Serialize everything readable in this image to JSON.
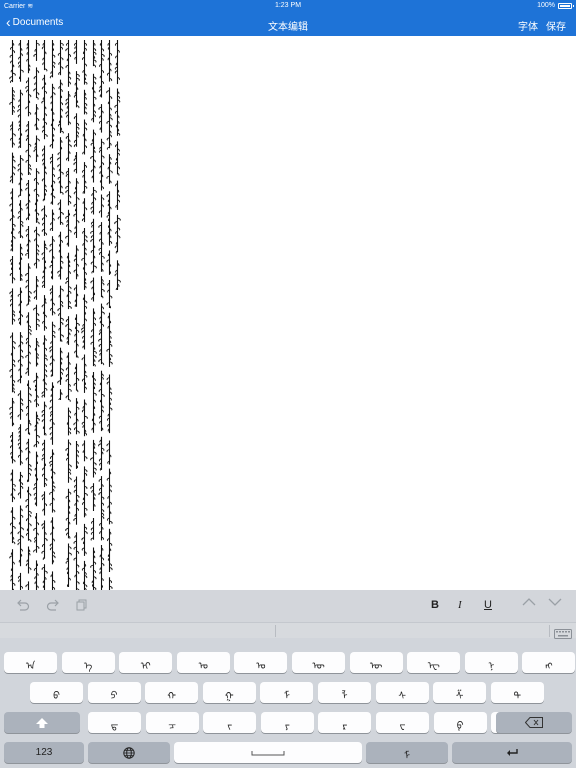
{
  "status_bar": {
    "carrier": "Carrier",
    "time": "1:23 PM",
    "battery": "100%"
  },
  "nav": {
    "back_label": "Documents",
    "title": "文本编辑",
    "font_label": "字体",
    "save_label": "保存"
  },
  "editor": {
    "columns": 14
  },
  "format_bar": {
    "undo_icon": "undo-icon",
    "redo_icon": "redo-icon",
    "copy_icon": "copy-icon",
    "bold": "B",
    "italic": "I",
    "underline": "U",
    "up_icon": "chevron-up-icon",
    "down_icon": "chevron-down-icon"
  },
  "keyboard": {
    "row1": [
      "ᠠ",
      "ᠡ",
      "ᠢ",
      "ᠣ",
      "ᠤ",
      "ᠥ",
      "ᠦ",
      "ᠧ",
      "ᠨ",
      "ᠩ"
    ],
    "row2": [
      "ᠪ",
      "ᠫ",
      "ᠬ",
      "ᠭ",
      "ᠮ",
      "ᠯ",
      "ᠰ",
      "ᠱ",
      "ᠲ"
    ],
    "row3": [
      "ᠳ",
      "ᠴ",
      "ᠵ",
      "ᠶ",
      "ᠷ",
      "ᠸ",
      "ᠹ",
      "ᠺ"
    ],
    "numbers_label": "123",
    "mongol_key": "ᠮ",
    "return_icon": "return-icon",
    "shift_icon": "shift-icon",
    "delete_icon": "delete-icon",
    "globe_icon": "globe-icon",
    "space_icon": "space-icon",
    "keyboard_icon": "keyboard-icon"
  }
}
